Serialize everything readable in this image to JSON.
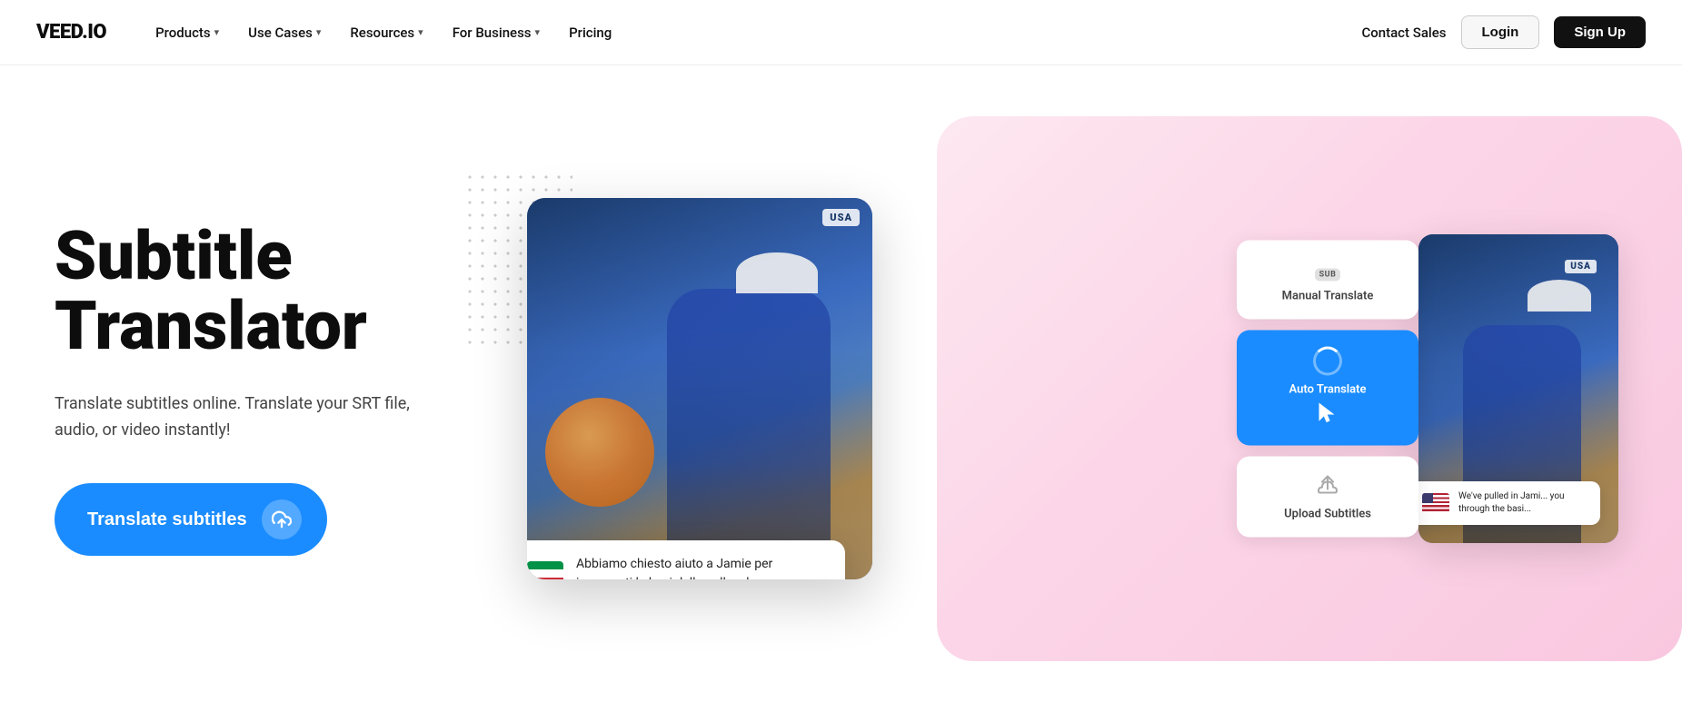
{
  "brand": {
    "logo": "VEED.IO"
  },
  "nav": {
    "products_label": "Products",
    "use_cases_label": "Use Cases",
    "resources_label": "Resources",
    "for_business_label": "For Business",
    "pricing_label": "Pricing",
    "contact_sales_label": "Contact Sales",
    "login_label": "Login",
    "signup_label": "Sign Up"
  },
  "hero": {
    "title_line1": "Subtitle",
    "title_line2": "Translator",
    "subtitle": "Translate subtitles online. Translate your SRT file, audio, or video instantly!",
    "cta_label": "Translate subtitles"
  },
  "panel": {
    "manual_translate_label": "Manual Translate",
    "auto_translate_label": "Auto Translate",
    "upload_subtitles_label": "Upload Subtitles"
  },
  "subtitle_overlay": {
    "italian_text": "Abbiamo chiesto aiuto a Jamie per insegnarti le basi della pallavolo"
  },
  "subtitle_right": {
    "text": "We've pulled in Jami... you through the basi..."
  },
  "usa_badge": "USA",
  "colors": {
    "cta_blue": "#1a8cff",
    "dark": "#0d0d0d",
    "text_gray": "#444"
  }
}
